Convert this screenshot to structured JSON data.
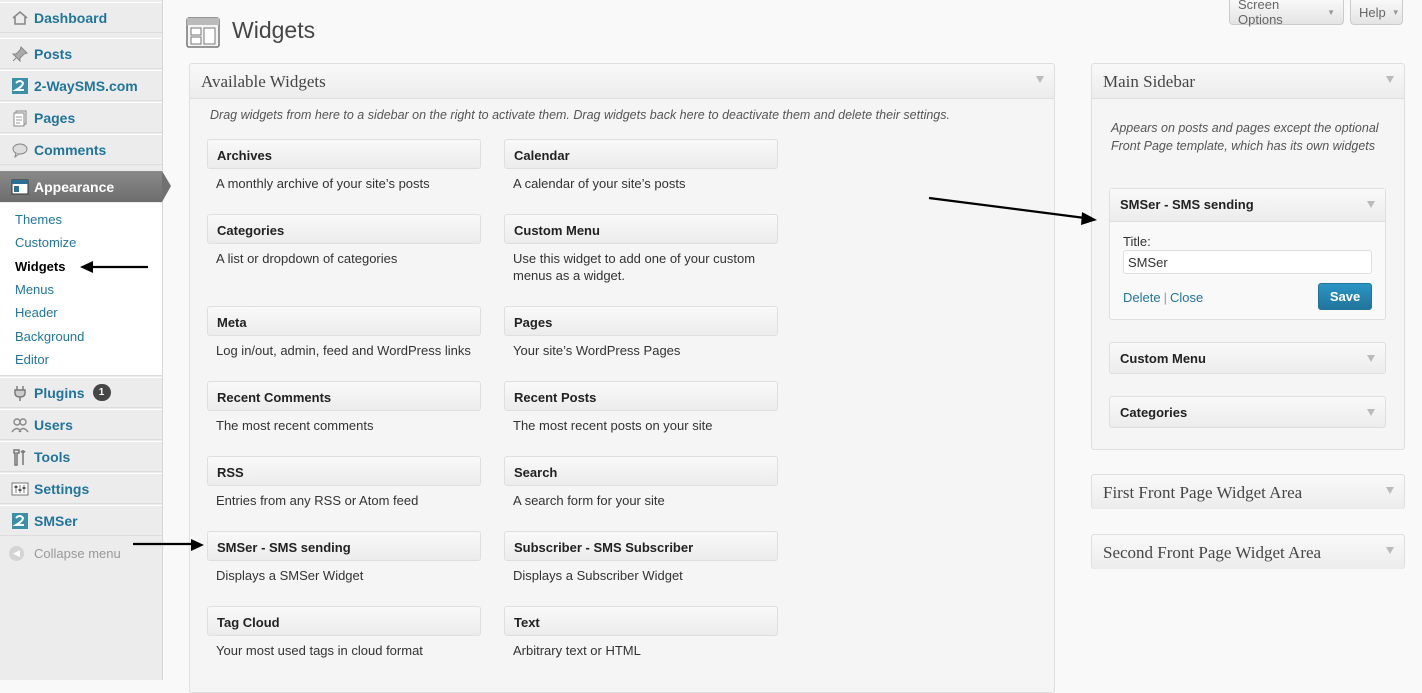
{
  "menu": {
    "dashboard": "Dashboard",
    "posts": "Posts",
    "twowaysms": "2-WaySMS.com",
    "pages": "Pages",
    "comments": "Comments",
    "appearance": "Appearance",
    "submenu": [
      "Themes",
      "Customize",
      "Widgets",
      "Menus",
      "Header",
      "Background",
      "Editor"
    ],
    "plugins": "Plugins",
    "plugins_count": "1",
    "users": "Users",
    "tools": "Tools",
    "settings": "Settings",
    "smser": "SMSer",
    "collapse": "Collapse menu"
  },
  "header": {
    "title": "Widgets",
    "screen_options": "Screen Options",
    "help": "Help"
  },
  "available": {
    "title": "Available Widgets",
    "description": "Drag widgets from here to a sidebar on the right to activate them. Drag widgets back here to deactivate them and delete their settings.",
    "widgets": [
      {
        "title": "Archives",
        "desc": "A monthly archive of your site’s posts"
      },
      {
        "title": "Calendar",
        "desc": "A calendar of your site’s posts"
      },
      {
        "title": "Categories",
        "desc": "A list or dropdown of categories"
      },
      {
        "title": "Custom Menu",
        "desc": "Use this widget to add one of your custom menus as a widget."
      },
      {
        "title": "Meta",
        "desc": "Log in/out, admin, feed and WordPress links"
      },
      {
        "title": "Pages",
        "desc": "Your site’s WordPress Pages"
      },
      {
        "title": "Recent Comments",
        "desc": "The most recent comments"
      },
      {
        "title": "Recent Posts",
        "desc": "The most recent posts on your site"
      },
      {
        "title": "RSS",
        "desc": "Entries from any RSS or Atom feed"
      },
      {
        "title": "Search",
        "desc": "A search form for your site"
      },
      {
        "title": "SMSer - SMS sending",
        "desc": "Displays a SMSer Widget"
      },
      {
        "title": "Subscriber - SMS Subscriber",
        "desc": "Displays a Subscriber Widget"
      },
      {
        "title": "Tag Cloud",
        "desc": "Your most used tags in cloud format"
      },
      {
        "title": "Text",
        "desc": "Arbitrary text or HTML"
      }
    ]
  },
  "main_sidebar": {
    "title": "Main Sidebar",
    "description": "Appears on posts and pages except the optional Front Page template, which has its own widgets",
    "open_widget": {
      "title": "SMSer - SMS sending",
      "field_label": "Title:",
      "field_value": "SMSer",
      "delete": "Delete",
      "separator": "|",
      "close": "Close",
      "save": "Save"
    },
    "widgets": [
      "Custom Menu",
      "Categories"
    ]
  },
  "other_sidebars": [
    "First Front Page Widget Area",
    "Second Front Page Widget Area"
  ]
}
